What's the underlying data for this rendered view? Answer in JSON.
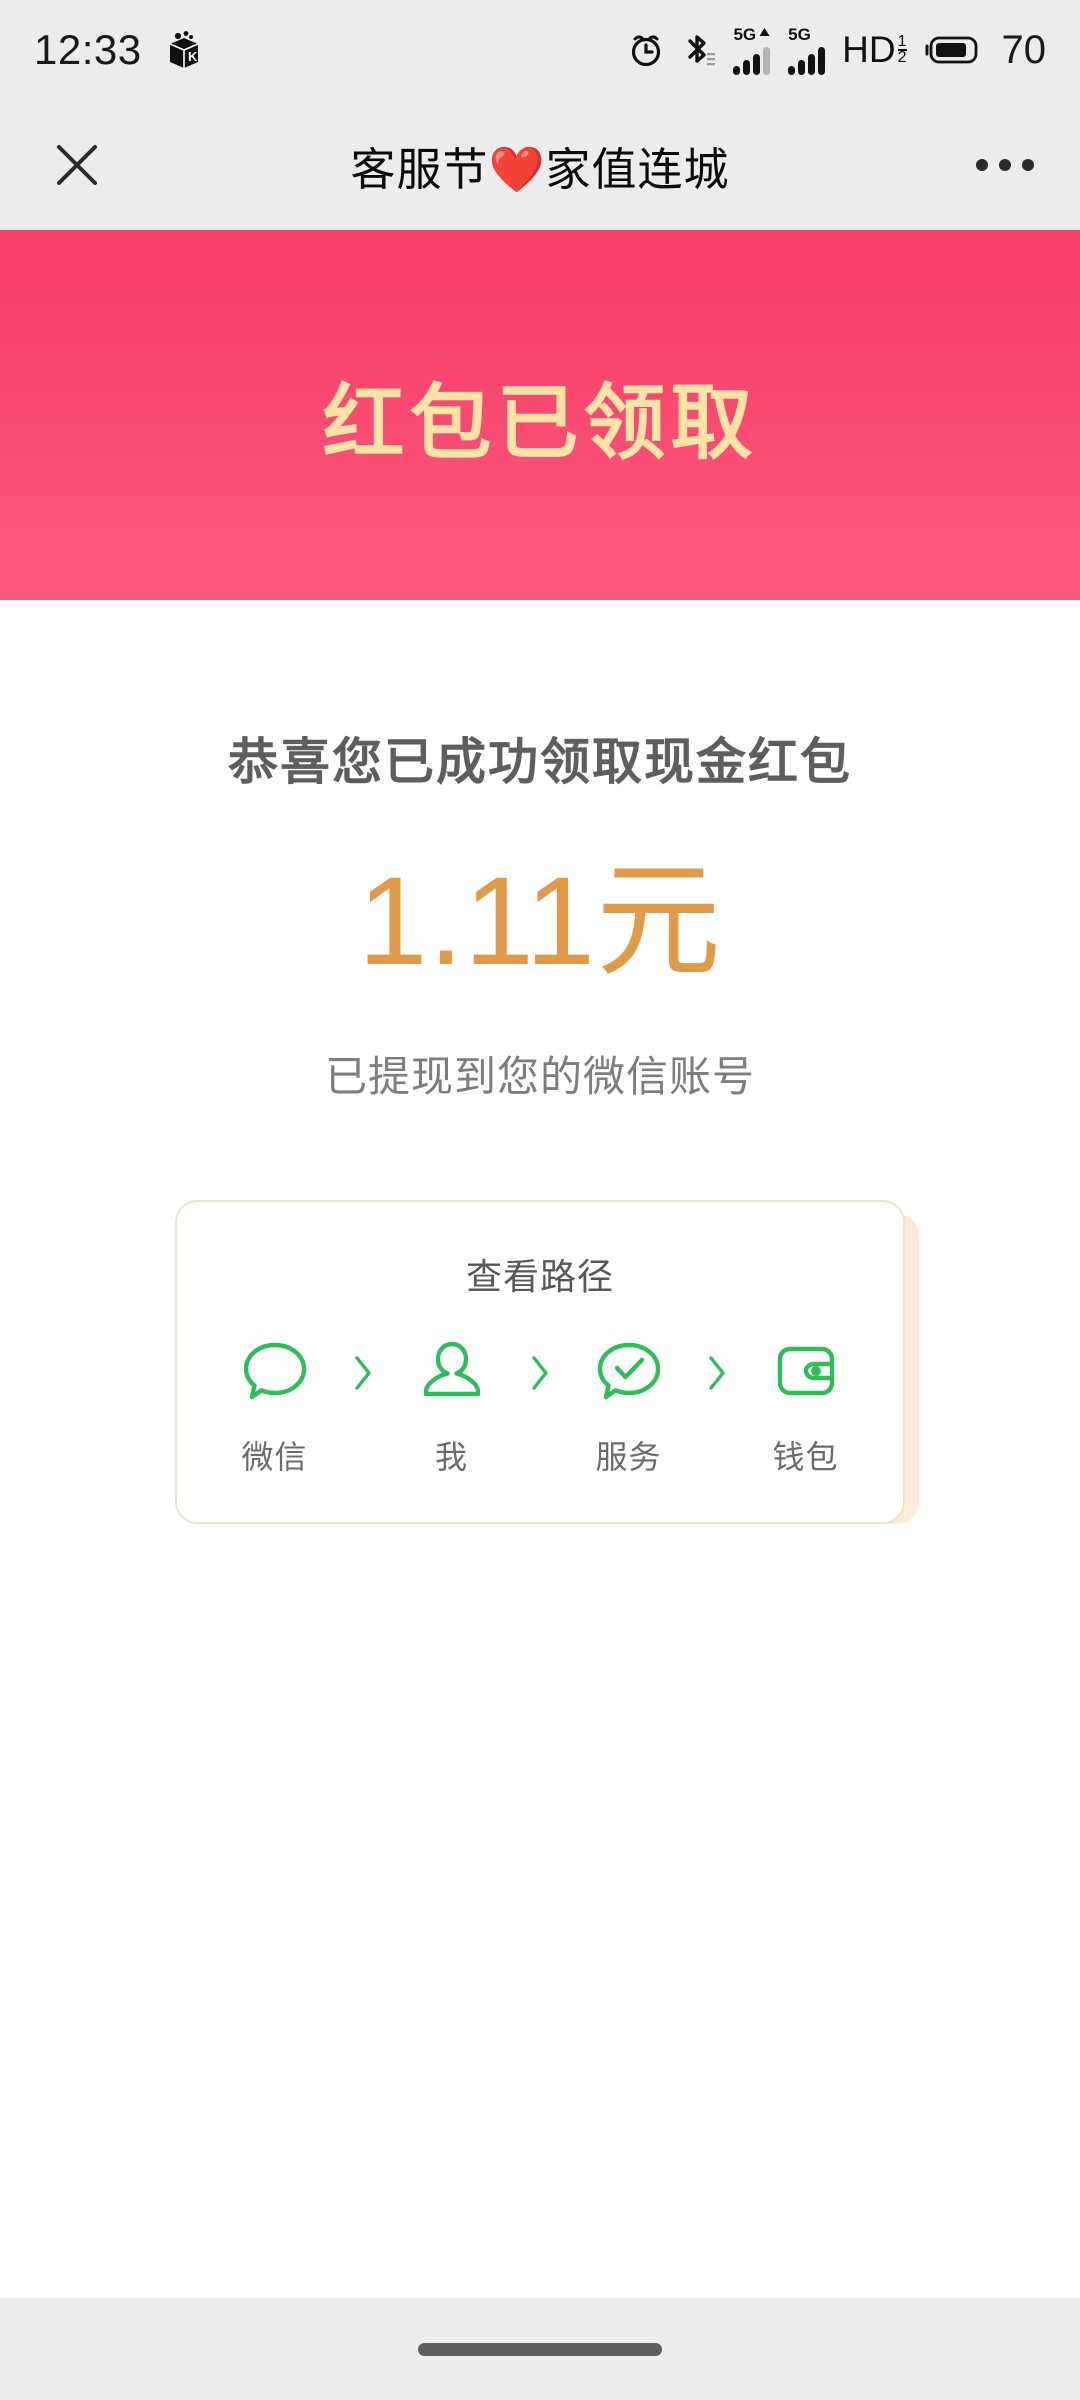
{
  "status_bar": {
    "time": "12:33",
    "battery_percent": "70",
    "icons": [
      {
        "name": "app-box-icon",
        "position": "left"
      },
      {
        "name": "alarm-clock-icon",
        "position": "right"
      },
      {
        "name": "bluetooth-icon",
        "position": "right"
      },
      {
        "name": "signal-5g-primary-icon",
        "label": "5G",
        "position": "right"
      },
      {
        "name": "signal-5g-secondary-icon",
        "label": "5G",
        "position": "right"
      },
      {
        "name": "hd-voice-icon",
        "label": "HD",
        "sub_top": "1",
        "sub_bottom": "2",
        "position": "right"
      },
      {
        "name": "battery-icon",
        "position": "right"
      }
    ],
    "signal_label": "5G",
    "hd_label": "HD",
    "hd_sub_top": "1",
    "hd_sub_bottom": "2"
  },
  "navbar": {
    "title": "客服节❤️家值连城",
    "close_label": "×",
    "more_label": "···"
  },
  "hero": {
    "title": "红包已领取",
    "gradient_top": "#F63F62",
    "gradient_bottom": "#FC6789",
    "title_color": "#FBE3A6"
  },
  "main": {
    "congrats": "恭喜您已成功领取现金红包",
    "amount": "1.11元",
    "amount_color": "#E09A4A",
    "withdrawn_note": "已提现到您的微信账号"
  },
  "path_card": {
    "title": "查看路径",
    "accent_color": "#2EBD59",
    "border_color": "#EDE2D0",
    "shadow_color": "#FCEBD8",
    "steps": [
      {
        "label": "微信",
        "icon": "wechat-bubble-icon"
      },
      {
        "label": "我",
        "icon": "person-icon"
      },
      {
        "label": "服务",
        "icon": "service-check-bubble-icon"
      },
      {
        "label": "钱包",
        "icon": "wallet-icon"
      }
    ],
    "separator": "chevron-right-icon"
  },
  "bottom_bar": {
    "home_indicator": "home-indicator-pill"
  }
}
